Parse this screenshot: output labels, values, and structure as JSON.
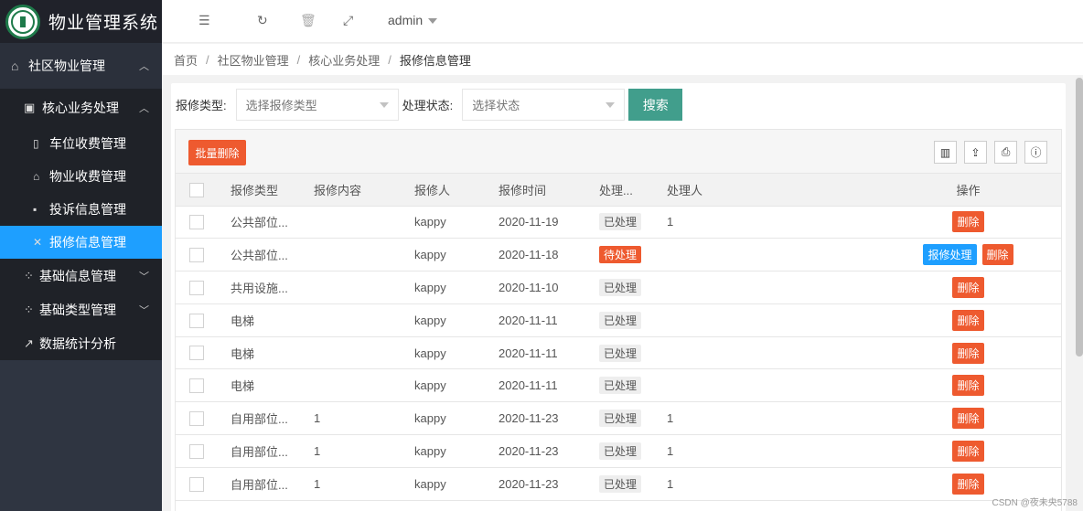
{
  "app": {
    "title": "物业管理系统",
    "logo_icon": "school-logo-icon"
  },
  "sidebar": {
    "top": {
      "label": "社区物业管理",
      "icon": "home-icon"
    },
    "section": {
      "label": "核心业务处理",
      "icon": "monitor-icon"
    },
    "items": [
      {
        "label": "车位收费管理",
        "icon": "doc-icon"
      },
      {
        "label": "物业收费管理",
        "icon": "house-icon"
      },
      {
        "label": "投诉信息管理",
        "icon": "square-icon"
      },
      {
        "label": "报修信息管理",
        "icon": "tools-icon",
        "active": true
      }
    ],
    "groups": [
      {
        "label": "基础信息管理",
        "icon": "grid-icon"
      },
      {
        "label": "基础类型管理",
        "icon": "grid-icon"
      },
      {
        "label": "数据统计分析",
        "icon": "chart-icon"
      }
    ]
  },
  "header": {
    "user": "admin"
  },
  "breadcrumb": [
    "首页",
    "社区物业管理",
    "核心业务处理",
    "报修信息管理"
  ],
  "filters": {
    "type_label": "报修类型:",
    "type_placeholder": "选择报修类型",
    "status_label": "处理状态:",
    "status_placeholder": "选择状态",
    "search_label": "搜索"
  },
  "toolbar": {
    "batch_delete": "批量删除"
  },
  "table": {
    "columns": [
      "报修类型",
      "报修内容",
      "报修人",
      "报修时间",
      "处理...",
      "处理人",
      "操作"
    ],
    "rows": [
      {
        "type": "公共部位...",
        "content": "",
        "reporter": "kappy",
        "time": "2020-11-19",
        "status": "已处理",
        "status_kind": "done",
        "handler": "1",
        "actions": [
          "删除"
        ]
      },
      {
        "type": "公共部位...",
        "content": "",
        "reporter": "kappy",
        "time": "2020-11-18",
        "status": "待处理",
        "status_kind": "pending",
        "handler": "",
        "actions": [
          "报修处理",
          "删除"
        ]
      },
      {
        "type": "共用设施...",
        "content": "",
        "reporter": "kappy",
        "time": "2020-11-10",
        "status": "已处理",
        "status_kind": "done",
        "handler": "",
        "actions": [
          "删除"
        ]
      },
      {
        "type": "电梯",
        "content": "",
        "reporter": "kappy",
        "time": "2020-11-11",
        "status": "已处理",
        "status_kind": "done",
        "handler": "",
        "actions": [
          "删除"
        ]
      },
      {
        "type": "电梯",
        "content": "",
        "reporter": "kappy",
        "time": "2020-11-11",
        "status": "已处理",
        "status_kind": "done",
        "handler": "",
        "actions": [
          "删除"
        ]
      },
      {
        "type": "电梯",
        "content": "",
        "reporter": "kappy",
        "time": "2020-11-11",
        "status": "已处理",
        "status_kind": "done",
        "handler": "",
        "actions": [
          "删除"
        ]
      },
      {
        "type": "自用部位...",
        "content": "1",
        "reporter": "kappy",
        "time": "2020-11-23",
        "status": "已处理",
        "status_kind": "done",
        "handler": "1",
        "actions": [
          "删除"
        ]
      },
      {
        "type": "自用部位...",
        "content": "1",
        "reporter": "kappy",
        "time": "2020-11-23",
        "status": "已处理",
        "status_kind": "done",
        "handler": "1",
        "actions": [
          "删除"
        ]
      },
      {
        "type": "自用部位...",
        "content": "1",
        "reporter": "kappy",
        "time": "2020-11-23",
        "status": "已处理",
        "status_kind": "done",
        "handler": "1",
        "actions": [
          "删除"
        ]
      }
    ]
  },
  "colors": {
    "accent": "#1e9fff",
    "danger": "#ee5a2f",
    "search": "#419e8c",
    "sidebar": "#2f3541"
  },
  "watermark": "CSDN @夜未央5788"
}
